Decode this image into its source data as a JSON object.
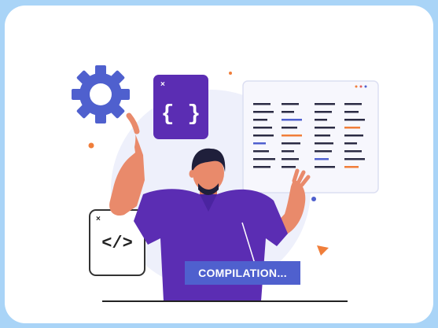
{
  "illustration": {
    "status_label": "COMPILATION...",
    "braces_glyph": "{ }",
    "tag_glyph": "</>",
    "close_glyph": "×",
    "colors": {
      "background": "#a9d4f7",
      "card": "#ffffff",
      "accent_purple": "#5b2db3",
      "accent_blue": "#4f60ce",
      "skin": "#e98a6b",
      "orange": "#f07e3a"
    }
  }
}
